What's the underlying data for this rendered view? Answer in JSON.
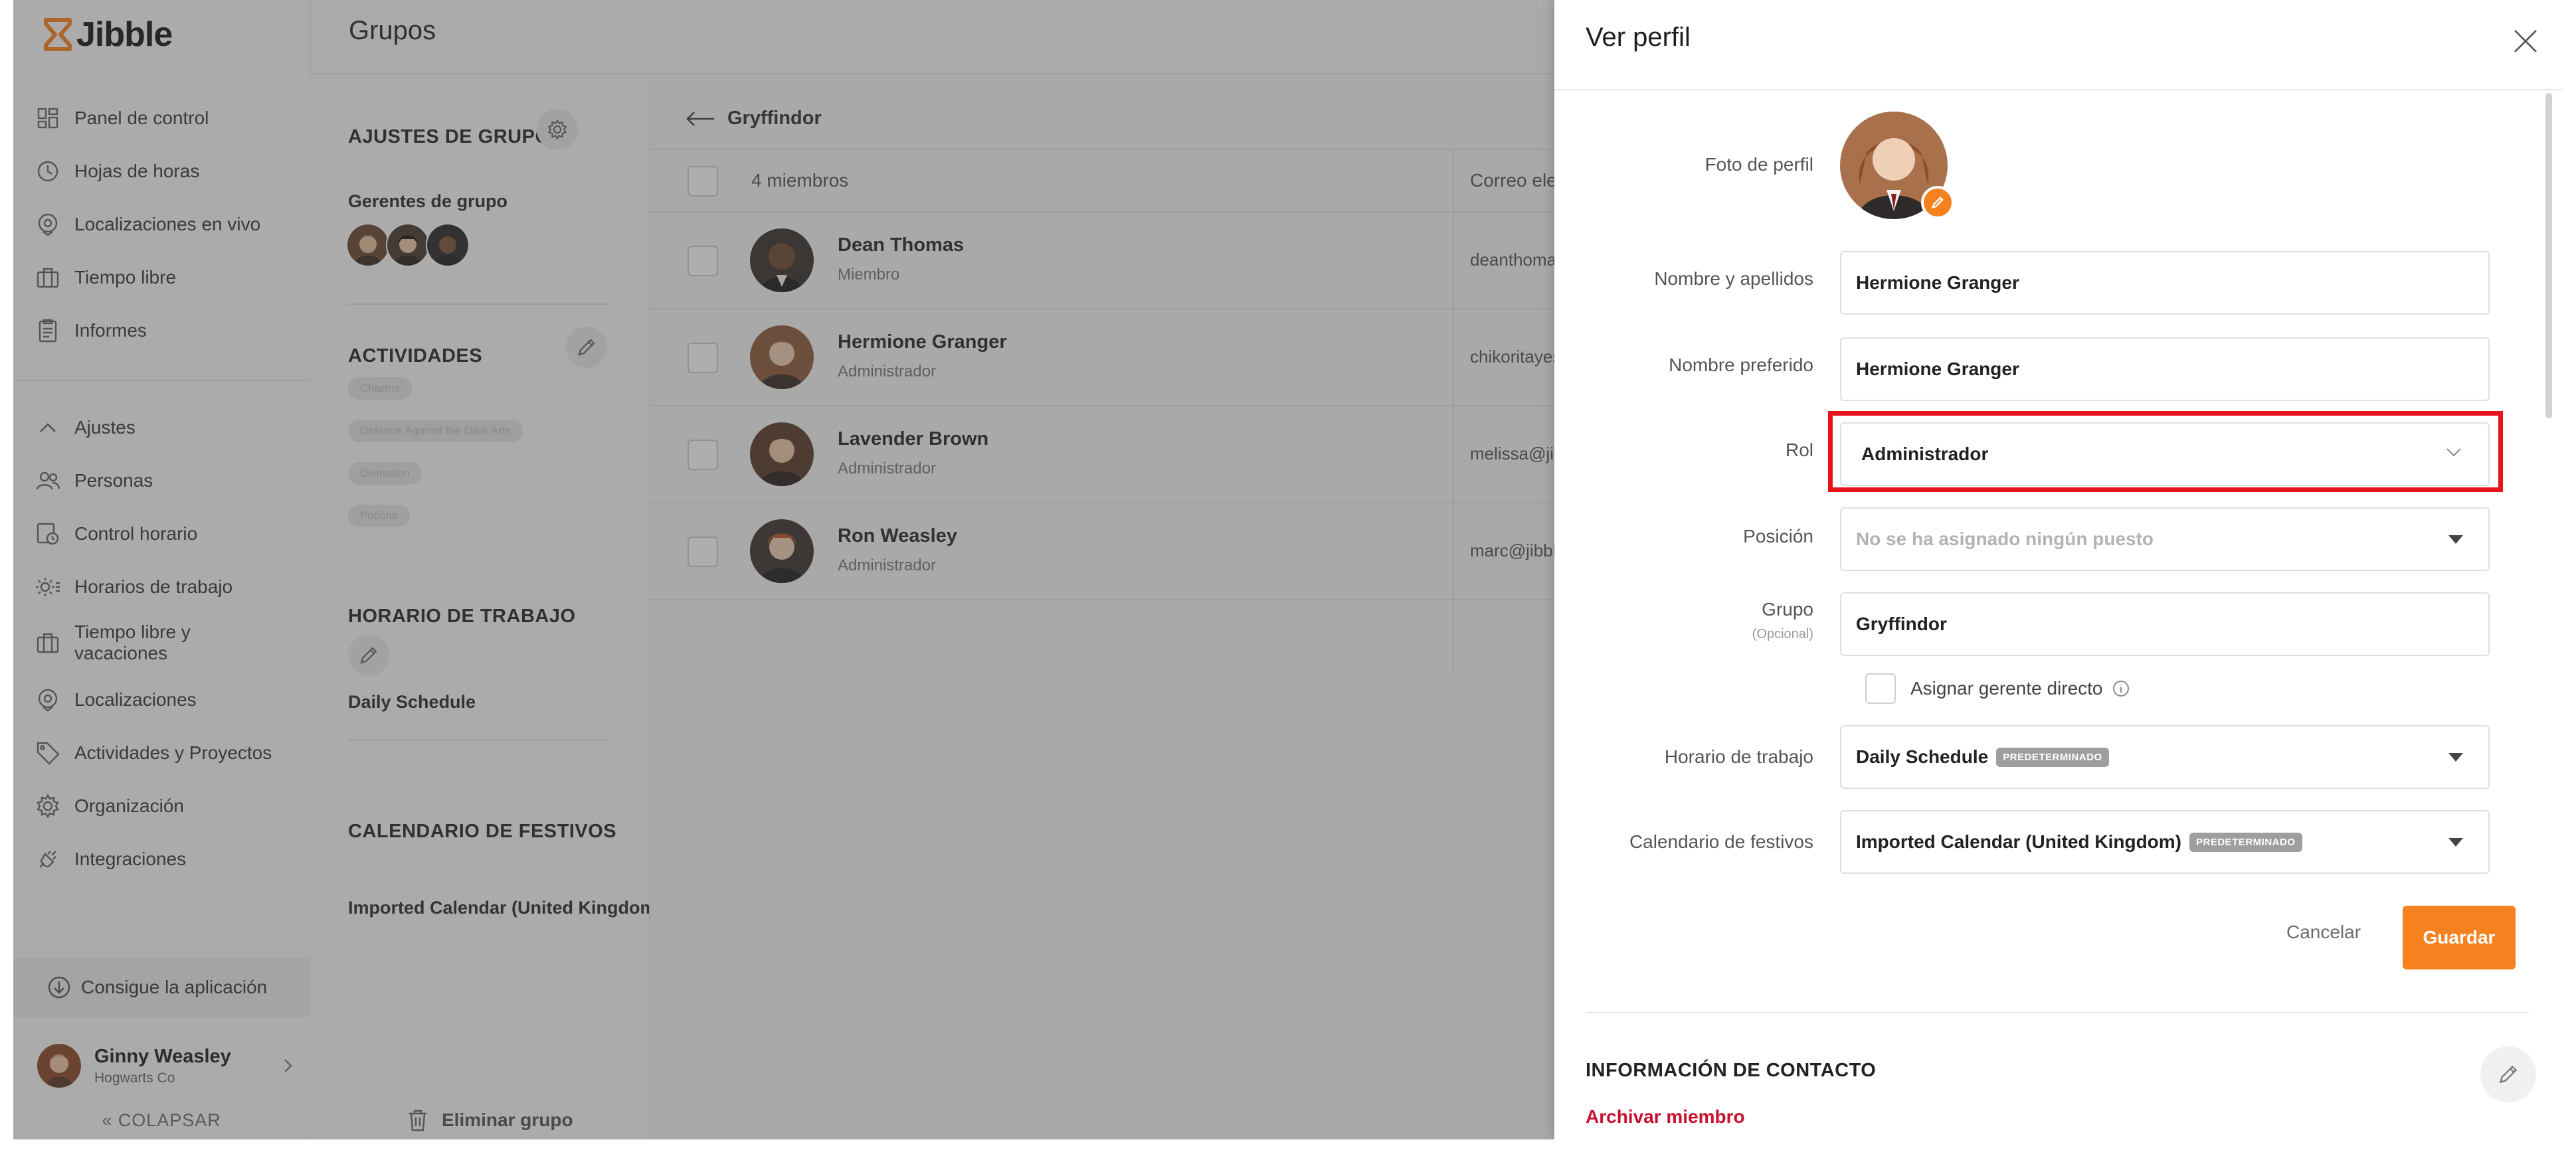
{
  "brand": {
    "name": "Jibble",
    "accent": "#f5821f",
    "highlight": "#e8141c"
  },
  "sidebar": {
    "items": [
      {
        "label": "Panel de control",
        "icon": "dashboard-icon"
      },
      {
        "label": "Hojas de horas",
        "icon": "clock-icon"
      },
      {
        "label": "Localizaciones en vivo",
        "icon": "location-pin-icon"
      },
      {
        "label": "Tiempo libre",
        "icon": "suitcase-icon"
      },
      {
        "label": "Informes",
        "icon": "report-icon"
      }
    ],
    "settings_toggle": "Ajustes",
    "settings_items": [
      {
        "label": "Personas",
        "icon": "people-icon"
      },
      {
        "label": "Control horario",
        "icon": "time-tracking-icon"
      },
      {
        "label": "Horarios de trabajo",
        "icon": "work-schedule-icon"
      },
      {
        "label": "Tiempo libre y vacaciones",
        "icon": "suitcase-icon"
      },
      {
        "label": "Localizaciones",
        "icon": "location-pin-icon"
      },
      {
        "label": "Actividades y Proyectos",
        "icon": "tag-icon"
      },
      {
        "label": "Organización",
        "icon": "gear-icon"
      },
      {
        "label": "Integraciones",
        "icon": "plug-icon"
      }
    ],
    "get_app": "Consigue la aplicación",
    "user": {
      "name": "Ginny Weasley",
      "org": "Hogwarts Co"
    },
    "collapse": "COLAPSAR"
  },
  "page": {
    "title": "Grupos"
  },
  "group_settings": {
    "settings_title": "AJUSTES DE GRUPO",
    "managers_title": "Gerentes de grupo",
    "activities_title": "ACTIVIDADES",
    "activities": [
      "Charms",
      "Defence Against the Dark Arts",
      "Divination",
      "Potions"
    ],
    "schedule_title": "HORARIO DE TRABAJO",
    "schedule_value": "Daily Schedule",
    "holidays_title": "CALENDARIO DE FESTIVOS",
    "holidays_value": "Imported Calendar (United Kingdom)",
    "delete_group": "Eliminar grupo"
  },
  "members": {
    "group_name": "Gryffindor",
    "count_label": "4 miembros",
    "email_header": "Correo electrónico",
    "rows": [
      {
        "name": "Dean Thomas",
        "role": "Miembro",
        "email": "deanthomas"
      },
      {
        "name": "Hermione Granger",
        "role": "Administrador",
        "email": "chikoritayes"
      },
      {
        "name": "Lavender Brown",
        "role": "Administrador",
        "email": "melissa@jibble"
      },
      {
        "name": "Ron Weasley",
        "role": "Administrador",
        "email": "marc@jibble"
      }
    ]
  },
  "profile": {
    "title": "Ver perfil",
    "photo_label": "Foto de perfil",
    "full_name_label": "Nombre y apellidos",
    "full_name": "Hermione Granger",
    "preferred_name_label": "Nombre preferido",
    "preferred_name": "Hermione Granger",
    "role_label": "Rol",
    "role": "Administrador",
    "position_label": "Posición",
    "position_placeholder": "No se ha asignado ningún puesto",
    "group_label": "Grupo",
    "group_optional": "(Opcional)",
    "group": "Gryffindor",
    "assign_manager": "Asignar gerente directo",
    "schedule_label": "Horario de trabajo",
    "schedule": "Daily Schedule",
    "schedule_badge": "PREDETERMINADO",
    "holidays_label": "Calendario de festivos",
    "holidays": "Imported Calendar (United Kingdom)",
    "holidays_badge": "PREDETERMINADO",
    "cancel": "Cancelar",
    "save": "Guardar",
    "contact_title": "INFORMACIÓN DE CONTACTO",
    "archive": "Archivar miembro"
  }
}
